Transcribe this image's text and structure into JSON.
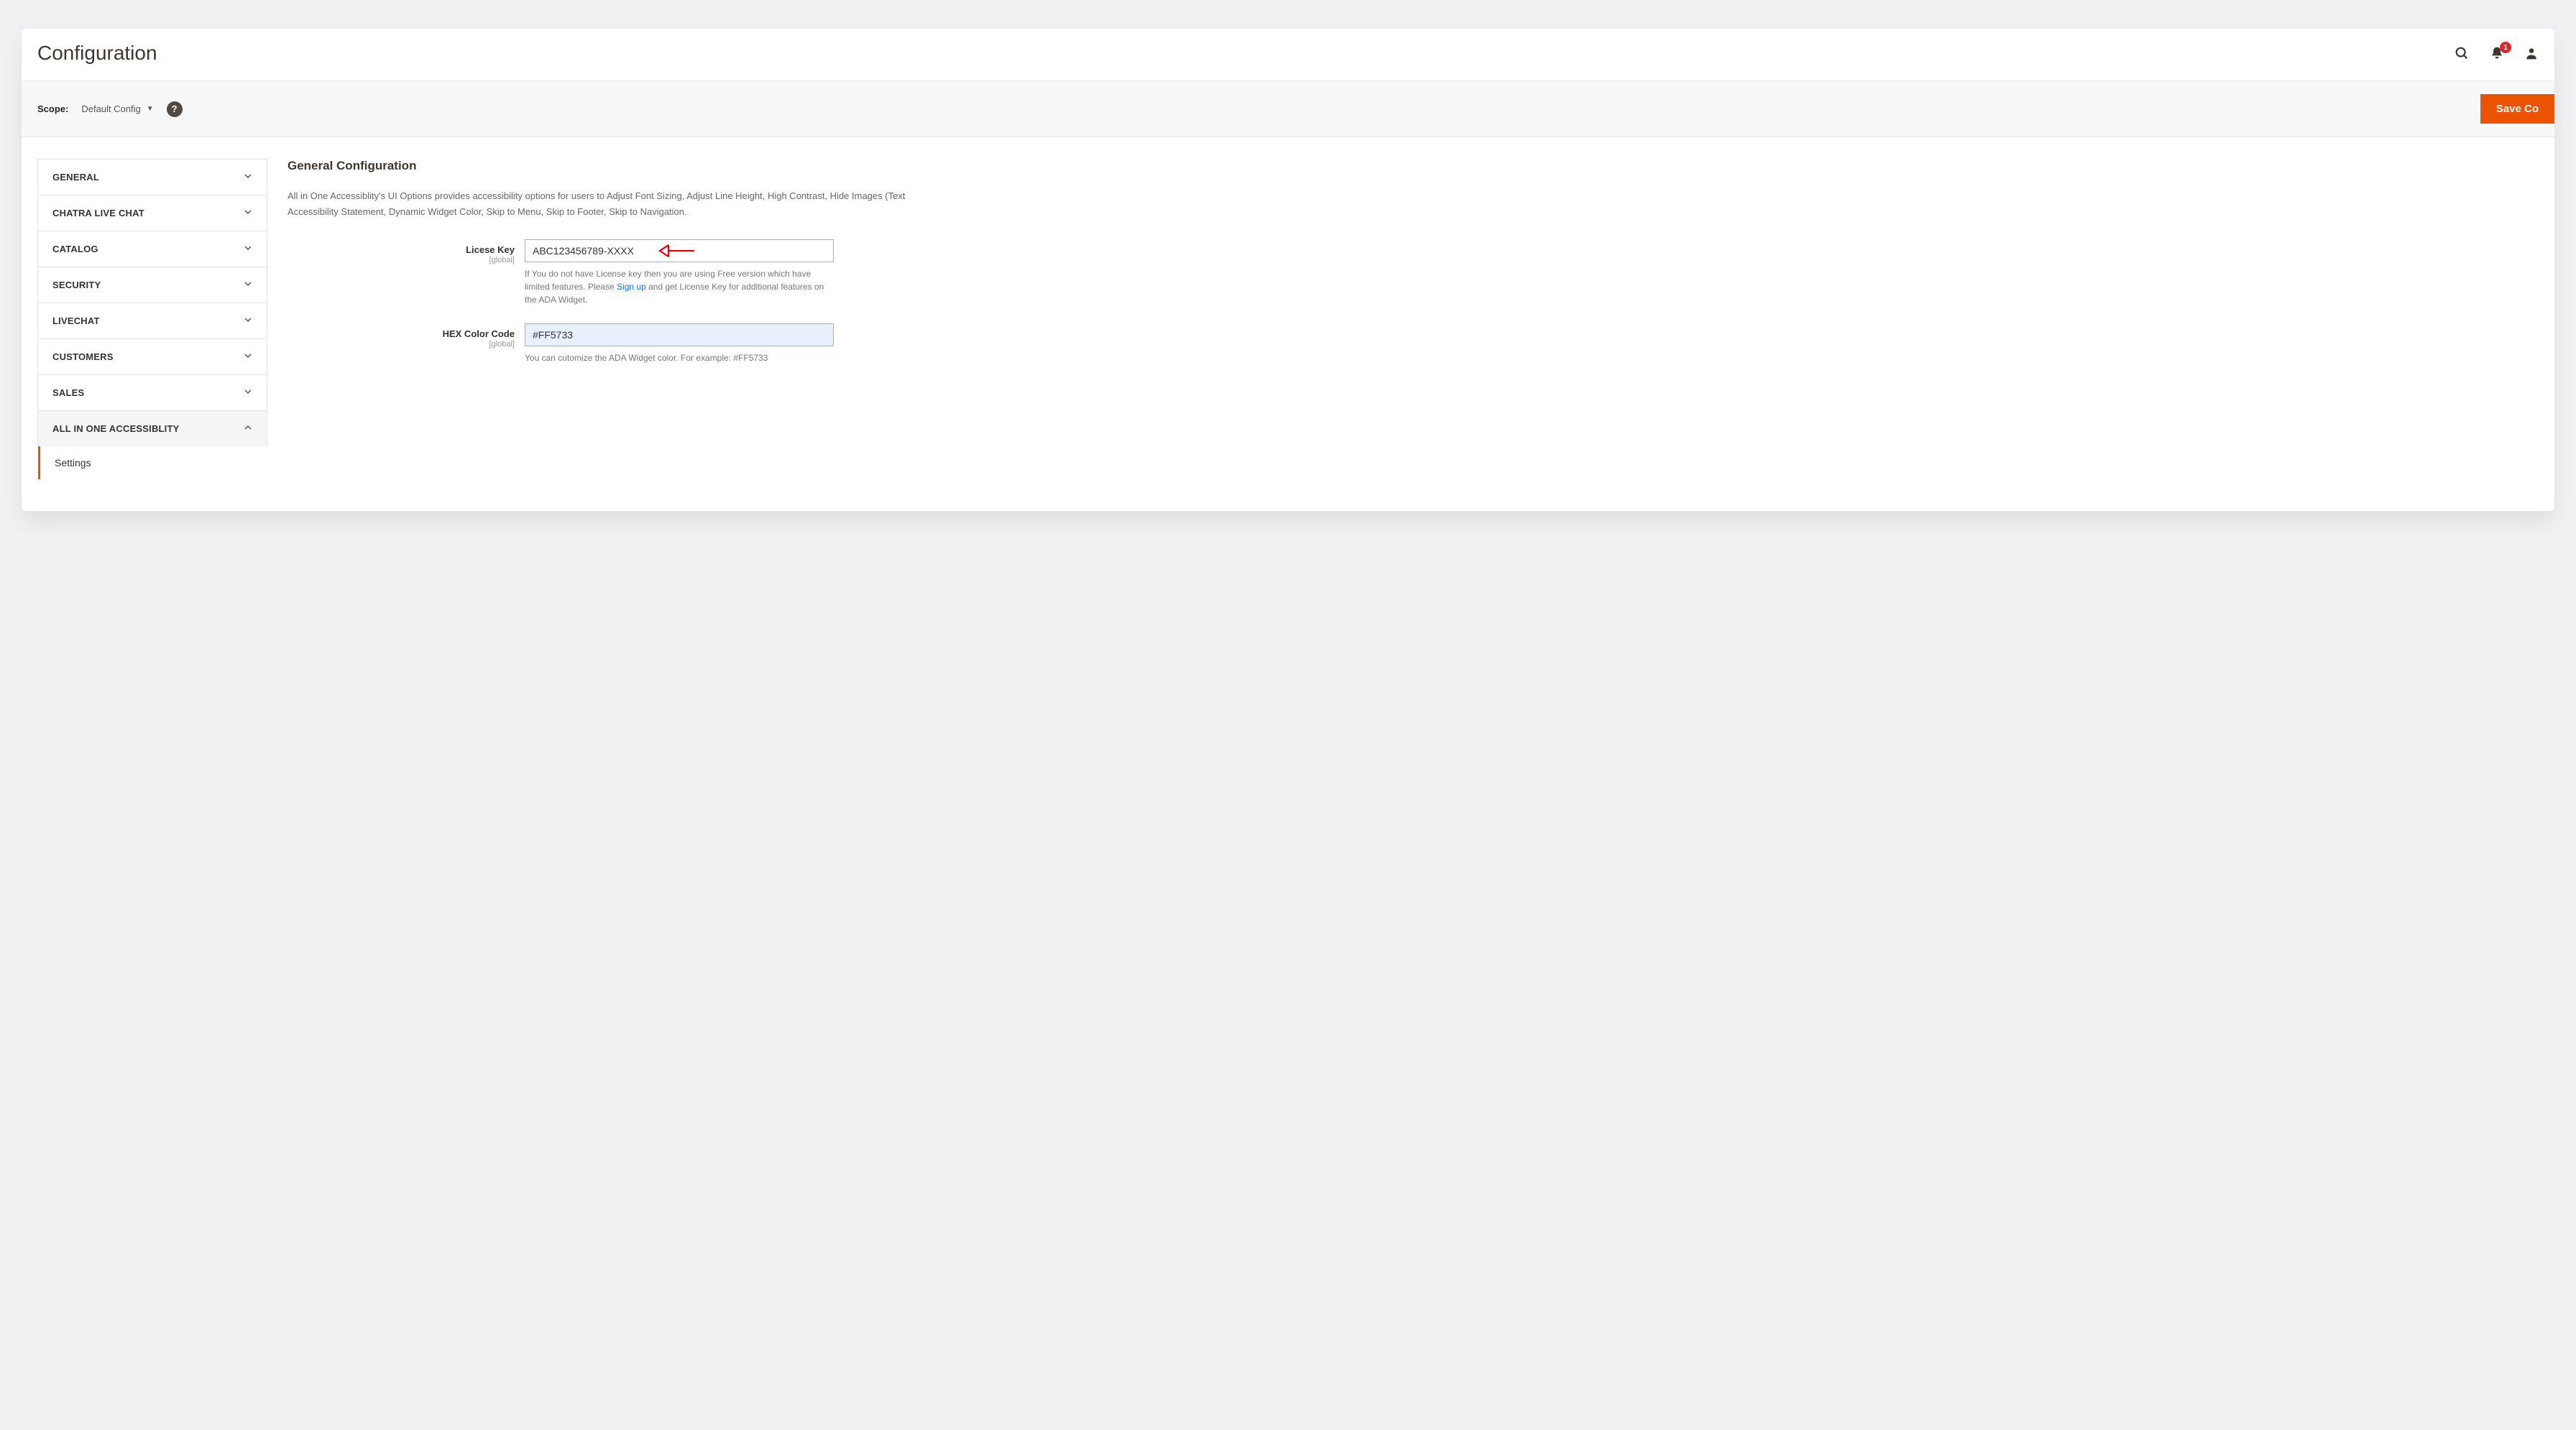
{
  "header": {
    "title": "Configuration",
    "notification_count": "1"
  },
  "toolbar": {
    "scope_label": "Scope:",
    "scope_value": "Default Config",
    "save_label": "Save Co"
  },
  "sidebar": {
    "items": [
      {
        "label": "GENERAL",
        "expanded": false
      },
      {
        "label": "CHATRA LIVE CHAT",
        "expanded": false
      },
      {
        "label": "CATALOG",
        "expanded": false
      },
      {
        "label": "SECURITY",
        "expanded": false
      },
      {
        "label": "LIVECHAT",
        "expanded": false
      },
      {
        "label": "CUSTOMERS",
        "expanded": false
      },
      {
        "label": "SALES",
        "expanded": false
      },
      {
        "label": "ALL IN ONE ACCESSIBLITY",
        "expanded": true
      }
    ],
    "sub_item": "Settings"
  },
  "main": {
    "section_title": "General Configuration",
    "desc_line1": "All in One Accessiblity's UI Options provides accessibility options for users to Adjust Font Sizing, Adjust Line Height, High Contrast, Hide Images (Text",
    "desc_line2": "Accessibility Statement, Dynamic Widget Color, Skip to Menu, Skip to Footer, Skip to Navigation.",
    "fields": {
      "license": {
        "label": "Licese Key",
        "scope": "[global]",
        "value": "ABC123456789-XXXX",
        "note_prefix": "If You do not have License key then you are using Free version which have limited features. Please ",
        "note_link": "Sign up",
        "note_suffix": " and get License Key for additional features on the ADA Widget."
      },
      "hex": {
        "label": "HEX Color Code",
        "scope": "[global]",
        "value": "#FF5733",
        "note": "You can cutomize the ADA Widget color. For example: #FF5733"
      }
    }
  }
}
